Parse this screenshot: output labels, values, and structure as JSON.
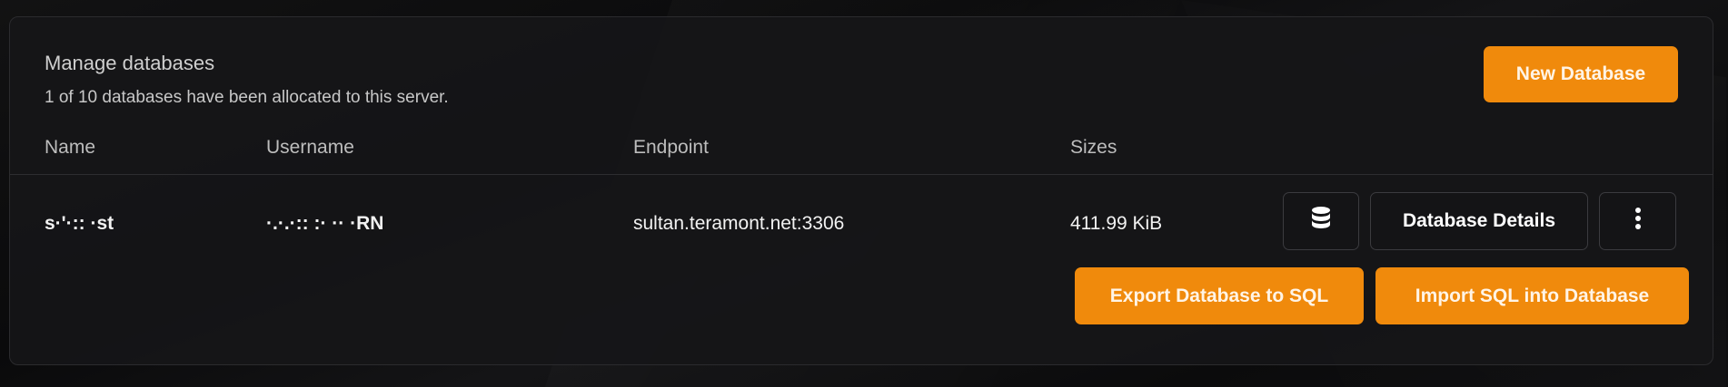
{
  "panel": {
    "title": "Manage databases",
    "subtitle": "1 of 10 databases have been allocated to this server.",
    "new_button": "New Database"
  },
  "columns": [
    "Name",
    "Username",
    "Endpoint",
    "Sizes"
  ],
  "rows": [
    {
      "name": "s·'·:: ·st",
      "username": "·.·.·:: :· ·· ·RN",
      "endpoint": "sultan.teramont.net:3306",
      "size": "411.99 KiB",
      "details_button": "Database Details",
      "export_button": "Export Database to SQL",
      "import_button": "Import SQL into Database",
      "db_icon": "database-icon",
      "more_icon": "more-vertical-icon"
    }
  ],
  "colors": {
    "accent": "#f08a0c",
    "panel_bg": "#161618",
    "page_bg": "#0b0b0c"
  }
}
